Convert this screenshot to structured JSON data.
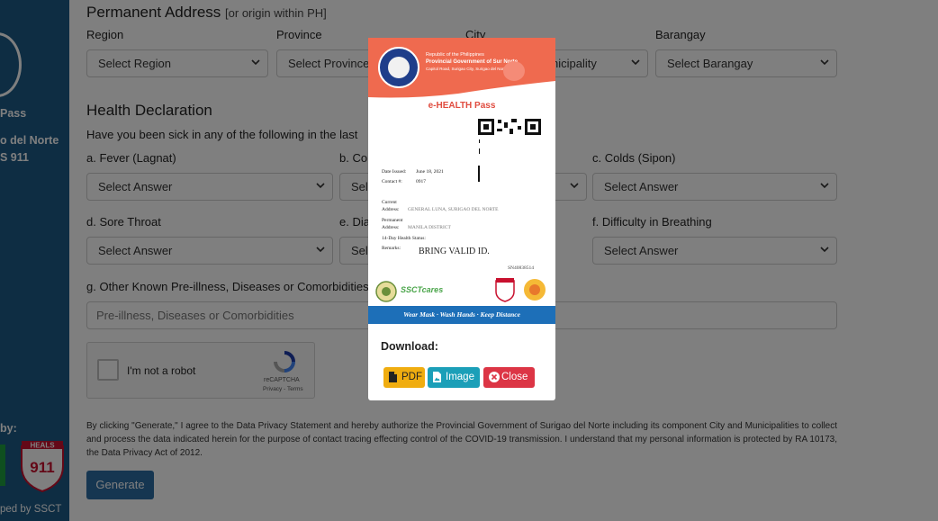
{
  "sidebar": {
    "title_fragment": "Pass",
    "province_fragment": "o del Norte",
    "hotline_fragment": "S 911",
    "powered_fragment": "by:",
    "developed_fragment": "ped by SSCT",
    "heals_logo_text": "HEALS 911"
  },
  "form": {
    "address_title": "Permanent Address",
    "address_note": "[or origin within PH]",
    "region_label": "Region",
    "region_value": "Select Region",
    "province_label": "Province",
    "province_value": "Select Province",
    "city_label": "City",
    "city_value": "nicipality",
    "barangay_label": "Barangay",
    "barangay_value": "Select Barangay",
    "health_title": "Health Declaration",
    "health_question": "Have you been sick in any of the following in the last",
    "fever_label": "a. Fever (Lagnat)",
    "fever_value": "Select Answer",
    "cough_label": "b. Co",
    "cough_value": "Sel",
    "colds_label": "c. Colds (Sipon)",
    "colds_value": "Select Answer",
    "sore_label": "d. Sore Throat",
    "sore_value": "Select Answer",
    "diarrhea_label": "e. Dia",
    "diarrhea_value": "Sel",
    "breathing_label": "f. Difficulty in Breathing",
    "breathing_value": "Select Answer",
    "other_label": "g. Other Known Pre-illness, Diseases or Comorbidities",
    "other_placeholder": "Pre-illness, Diseases or Comorbidities",
    "captcha_label": "I'm not a robot",
    "captcha_brand": "reCAPTCHA",
    "captcha_links": "Privacy - Terms",
    "disclaimer": "By clicking \"Generate,\" I agree to the Data Privacy Statement and hereby authorize the Provincial Government of Surigao del Norte including its component City and Municipalities to collect and process the data indicated herein for the purpose of contact tracing effecting control of the COVID-19 transmission. I understand that my personal information is protected by RA 10173, the Data Privacy Act of 2012.",
    "generate_label": "Generate"
  },
  "modal": {
    "pass": {
      "header_line1": "Republic of the Philippines",
      "header_line2": "Provincial Government of Sur          Norte",
      "header_line3": "Capitol Road, Surigao City, Surigao del Norte 8400",
      "title": "e-HEALTH Pass",
      "date_issued_label": "Date Issued:",
      "date_issued_value": "June 18, 2021",
      "contact_label": "Contact #:",
      "contact_value": "0917",
      "current_label": "Current",
      "address_label": "Address:",
      "current_value": "GENERAL LUNA, SURIGAO DEL NORTE",
      "permanent_label": "Permanent",
      "permanent_address_label": "Address:",
      "permanent_value": "MANILA DISTRICT",
      "health_status_label": "14-Day Health Status:",
      "remarks_label": "Remarks:",
      "remarks_value": "BRING VALID ID.",
      "serial": "SN40838514",
      "ssct_logo_text": "SSCTcares",
      "slogan": "Wear Mask  ·  Wash Hands  ·  Keep Distance"
    },
    "download_label": "Download:",
    "pdf_label": "PDF",
    "image_label": "Image",
    "close_label": "Close"
  },
  "colors": {
    "sidebar": "#1d5a86",
    "pass_header": "#ef6a4f",
    "pdf_button": "#f0ad10",
    "image_button": "#1b9fb8",
    "close_button": "#dc3545",
    "generate_button": "#2d6ca2",
    "slogan_strip": "#1d6fb8"
  }
}
